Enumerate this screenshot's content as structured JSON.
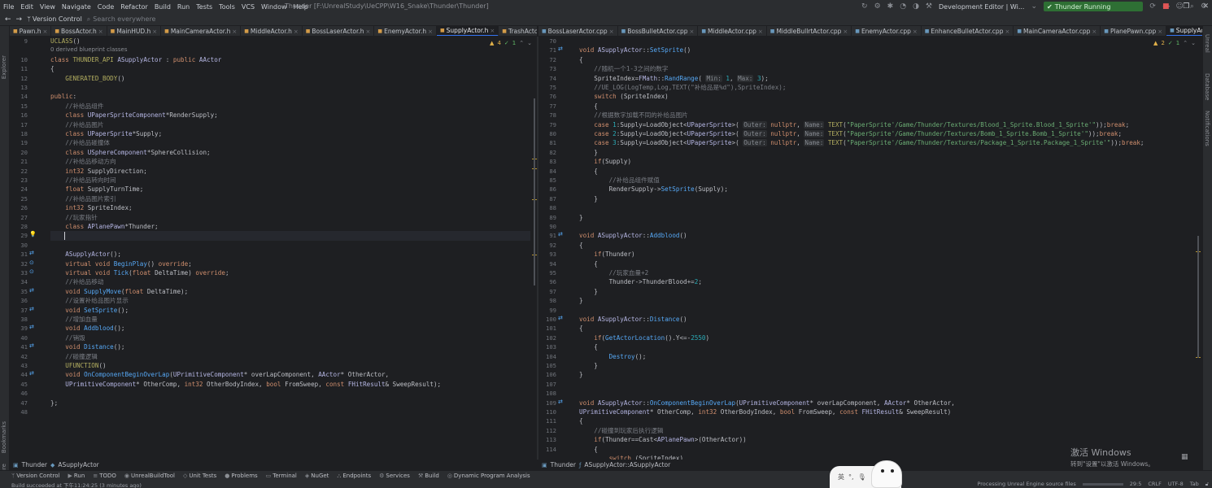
{
  "menubar": {
    "items": [
      "File",
      "Edit",
      "View",
      "Navigate",
      "Code",
      "Refactor",
      "Build",
      "Run",
      "Tests",
      "Tools",
      "VCS",
      "Window",
      "Help"
    ],
    "window_title": "Thunder [F:\\UnrealStudy\\UeCPP\\W16_Snake\\Thunder\\Thunder]"
  },
  "toolbar": {
    "vcs": "Version Control",
    "search_placeholder": "Search everywhere",
    "config": "Development Editor | Wi...",
    "run_status": "Thunder Running"
  },
  "left_tabs": [
    "Pawn.h",
    "BossActor.h",
    "MainHUD.h",
    "MainCameraActor.h",
    "MiddleActor.h",
    "BossLaserActor.h",
    "EnemyActor.h",
    "SupplyActor.h",
    "TrashActor.h"
  ],
  "left_active_tab": "SupplyActor.h",
  "right_tabs": [
    "BossLaserActor.cpp",
    "BossBulletActor.cpp",
    "MiddleActor.cpp",
    "MiddleBullrtActor.cpp",
    "EnemyActor.cpp",
    "EnhanceBulletActor.cpp",
    "MainCameraActor.cpp",
    "PlanePawn.cpp",
    "SupplyActor.cpp"
  ],
  "right_active_tab": "SupplyActor.cpp",
  "left_inspections": {
    "warnings": "4",
    "ok": "1"
  },
  "right_inspections": {
    "warnings": "2",
    "ok": "1"
  },
  "left_editor": {
    "hint": "0 derived blueprint classes",
    "line_numbers": [
      "9",
      "10",
      "11",
      "12",
      "13",
      "14",
      "15",
      "16",
      "17",
      "18",
      "19",
      "20",
      "21",
      "22",
      "23",
      "24",
      "25",
      "26",
      "27",
      "28",
      "29",
      "30",
      "31",
      "32",
      "33",
      "34",
      "35",
      "36",
      "37",
      "38",
      "39",
      "40",
      "41",
      "42",
      "43",
      "44",
      "45",
      "46",
      "47",
      "48"
    ],
    "code": [
      "UCLASS()",
      "class THUNDER_API ASupplyActor : public AActor",
      "{",
      "    GENERATED_BODY()",
      "",
      "public:",
      "    //补给品组件",
      "    class UPaperSpriteComponent*RenderSupply;",
      "    //补给品图片",
      "    class UPaperSprite*Supply;",
      "    //补给品碰撞体",
      "    class USphereComponent*SphereCollision;",
      "    //补给品移动方向",
      "    int32 SupplyDirection;",
      "    //补给品转向时间",
      "    float SupplyTurnTime;",
      "    //补给品图片索引",
      "    int32 SpriteIndex;",
      "    //玩家指针",
      "    class APlanePawn*Thunder;",
      "",
      "",
      "    ASupplyActor();",
      "    virtual void BeginPlay() override;",
      "    virtual void Tick(float DeltaTime) override;",
      "    //补给品移动",
      "    void SupplyMove(float DeltaTime);",
      "    //设置补给品图片显示",
      "    void SetSprite();",
      "    //增加血量",
      "    void Addblood();",
      "    //销毁",
      "    void Distance();",
      "    //碰撞逻辑",
      "    UFUNCTION()",
      "    void OnComponentBeginOverLap(UPrimitiveComponent* overLapComponent, AActor* OtherActor,",
      "    UPrimitiveComponent* OtherComp, int32 OtherBodyIndex, bool FromSweep, const FHitResult& SweepResult);",
      "",
      "};",
      ""
    ]
  },
  "right_editor": {
    "line_numbers": [
      "70",
      "71",
      "72",
      "73",
      "74",
      "75",
      "76",
      "77",
      "78",
      "79",
      "80",
      "81",
      "82",
      "83",
      "84",
      "85",
      "86",
      "87",
      "88",
      "89",
      "90",
      "91",
      "92",
      "93",
      "94",
      "95",
      "96",
      "97",
      "98",
      "99",
      "100",
      "101",
      "102",
      "103",
      "104",
      "105",
      "106",
      "107",
      "108",
      "109",
      "110",
      "111",
      "112",
      "113",
      "114"
    ],
    "code": [
      "",
      "void ASupplyActor::SetSprite()",
      "{",
      "    //随机一个1-3之间的数字",
      "    SpriteIndex=FMath::RandRange( Min: 1, Max: 3);",
      "    //UE_LOG(LogTemp,Log,TEXT(\"补给品是%d\"),SpriteIndex);",
      "    switch (SpriteIndex)",
      "    {",
      "    //根据数字加载不同的补给品图片",
      "    case 1:Supply=LoadObject<UPaperSprite>( Outer: nullptr, Name: TEXT(\"PaperSprite'/Game/Thunder/Textures/Blood_1_Sprite.Blood_1_Sprite'\"));break;",
      "    case 2:Supply=LoadObject<UPaperSprite>( Outer: nullptr, Name: TEXT(\"PaperSprite'/Game/Thunder/Textures/Bomb_1_Sprite.Bomb_1_Sprite'\"));break;",
      "    case 3:Supply=LoadObject<UPaperSprite>( Outer: nullptr, Name: TEXT(\"PaperSprite'/Game/Thunder/Textures/Package_1_Sprite.Package_1_Sprite'\"));break;",
      "    }",
      "    if(Supply)",
      "    {",
      "        //补给品组件赋值",
      "        RenderSupply->SetSprite(Supply);",
      "    }",
      "",
      "}",
      "",
      "void ASupplyActor::Addblood()",
      "{",
      "    if(Thunder)",
      "    {",
      "        //玩家血量+2",
      "        Thunder->ThunderBlood+=2;",
      "    }",
      "}",
      "",
      "void ASupplyActor::Distance()",
      "{",
      "    if(GetActorLocation().Y<=-2550)",
      "    {",
      "        Destroy();",
      "    }",
      "}",
      "",
      "",
      "void ASupplyActor::OnComponentBeginOverLap(UPrimitiveComponent* overLapComponent, AActor* OtherActor,",
      "UPrimitiveComponent* OtherComp, int32 OtherBodyIndex, bool FromSweep, const FHitResult& SweepResult)",
      "{",
      "    //碰撞到玩家后执行逻辑",
      "    if(Thunder==Cast<APlanePawn>(OtherActor))",
      "    {",
      "        switch (SpriteIndex)"
    ]
  },
  "breadcrumbs": {
    "left": [
      "Thunder",
      "ASupplyActor"
    ],
    "right": [
      "Thunder",
      "ASupplyActor::ASupplyActor"
    ]
  },
  "bottom_tools": [
    "Version Control",
    "Run",
    "TODO",
    "UnrealBuildTool",
    "Unit Tests",
    "Problems",
    "Terminal",
    "NuGet",
    "Endpoints",
    "Services",
    "Build",
    "Dynamic Program Analysis"
  ],
  "left_tool_labels": [
    "Explorer",
    "Bookmarks",
    "Structure"
  ],
  "right_tool_labels": [
    "Unreal",
    "Database",
    "Notifications"
  ],
  "status": {
    "message": "Build succeeded at 下午11:24:25 (3 minutes ago)",
    "process": "Processing Unreal Engine source files",
    "position": "29:5",
    "line_ending": "CRLF",
    "encoding": "UTF-8",
    "indent": "Tab"
  },
  "watermark": {
    "line1": "激活 Windows",
    "line2": "转到\"设置\"以激活 Windows。"
  },
  "ime": {
    "lang": "英",
    "punct": "°,"
  },
  "colors": {
    "accent": "#3574f0",
    "run_green": "#2e6f34",
    "background": "#1e1f22",
    "panel": "#2b2d30"
  }
}
